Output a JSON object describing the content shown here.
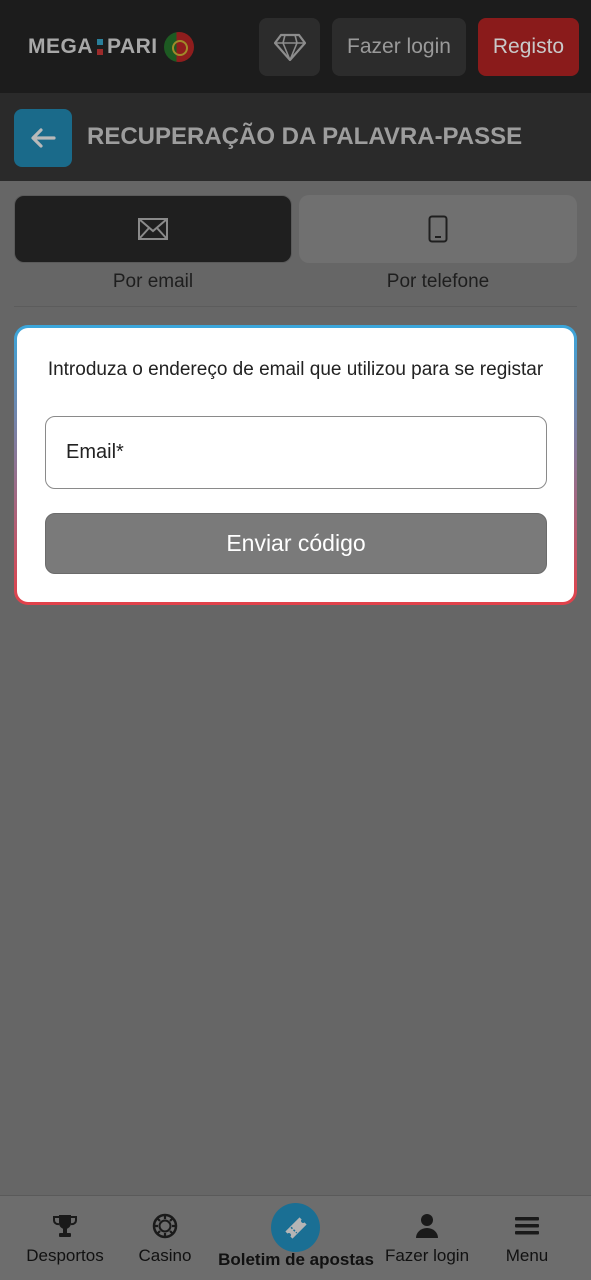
{
  "header": {
    "logo_text_left": "MEGA",
    "logo_text_right": "PARI",
    "login_label": "Fazer login",
    "register_label": "Registo",
    "diamond_icon": "diamond-icon"
  },
  "titlebar": {
    "title": "RECUPERAÇÃO DA PALAVRA-PASSE",
    "back_icon": "arrow-left-icon"
  },
  "tabs": [
    {
      "label": "Por email",
      "icon": "envelope-icon",
      "active": true
    },
    {
      "label": "Por telefone",
      "icon": "phone-icon",
      "active": false
    }
  ],
  "card": {
    "instruction": "Introduza o endereço de email que utilizou para se registar",
    "email_placeholder": "Email*",
    "submit_label": "Enviar código"
  },
  "bottom_nav": {
    "items": [
      {
        "label": "Desportos",
        "icon": "trophy-icon"
      },
      {
        "label": "Casino",
        "icon": "casino-chip-icon"
      },
      {
        "label": "Boletim de apostas",
        "icon": "ticket-icon"
      },
      {
        "label": "Fazer login",
        "icon": "user-icon"
      },
      {
        "label": "Menu",
        "icon": "hamburger-icon"
      }
    ]
  },
  "colors": {
    "overlay": "#666666",
    "card_gradient_top": "#3aa6db",
    "card_gradient_bottom": "#e2414a",
    "accent": "#1a6f94",
    "register": "#8a1b1b"
  }
}
